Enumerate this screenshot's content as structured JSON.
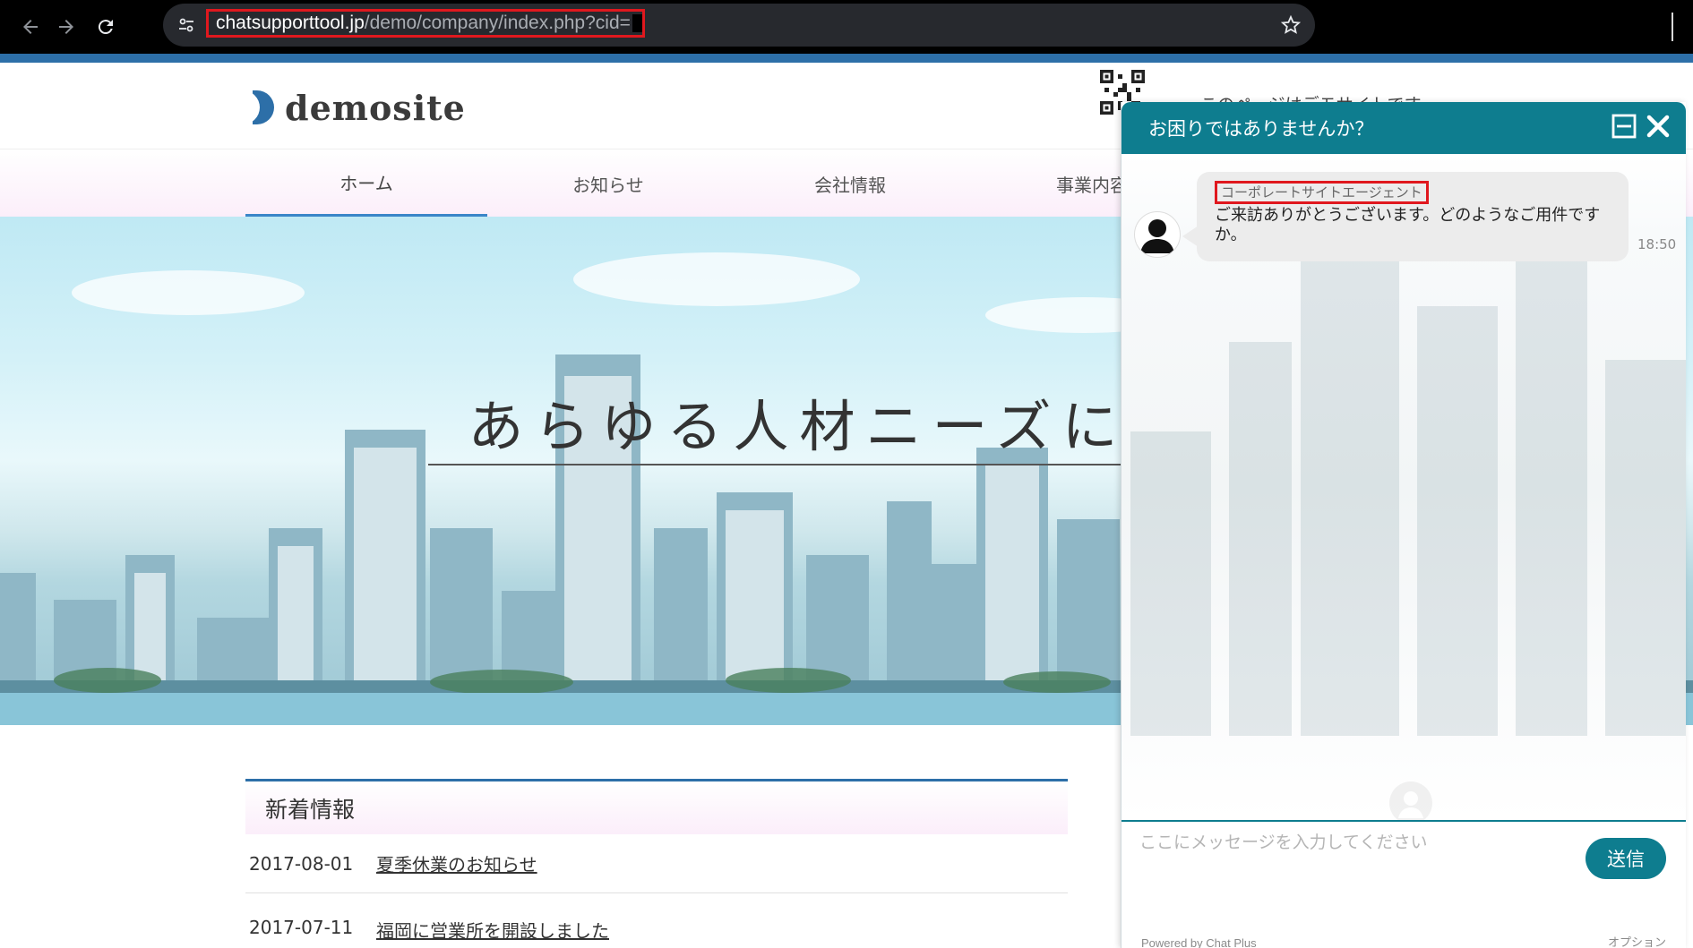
{
  "browser": {
    "url_host": "chatsupporttool.jp",
    "url_path": "/demo/company/index.php?cid="
  },
  "site": {
    "logo_text": "demosite",
    "header_notice": "このページはデモサイトです",
    "nav": [
      "ホーム",
      "お知らせ",
      "会社情報",
      "事業内容"
    ],
    "hero_title": "あらゆる人材ニーズに対応",
    "news": {
      "heading": "新着情報",
      "items": [
        {
          "date": "2017-08-01",
          "title": "夏季休業のお知らせ"
        },
        {
          "date": "2017-07-11",
          "title": "福岡に営業所を開設しました"
        }
      ]
    }
  },
  "chat": {
    "title": "お困りではありませんか？",
    "sender_name": "コーポレートサイトエージェント",
    "message": "ご来訪ありがとうございます。どのようなご用件ですか。",
    "time": "18:50",
    "input_placeholder": "ここにメッセージを入力してください",
    "send_label": "送信",
    "powered_by": "Powered by Chat Plus",
    "options_label": "オプション",
    "accent_color": "#0e7d8f"
  },
  "icons": {
    "back": "arrow-left-icon",
    "forward": "arrow-right-icon",
    "reload": "reload-icon",
    "site_info": "tune-icon",
    "bookmark": "star-icon",
    "minimize": "minimize-icon",
    "close": "close-icon"
  }
}
